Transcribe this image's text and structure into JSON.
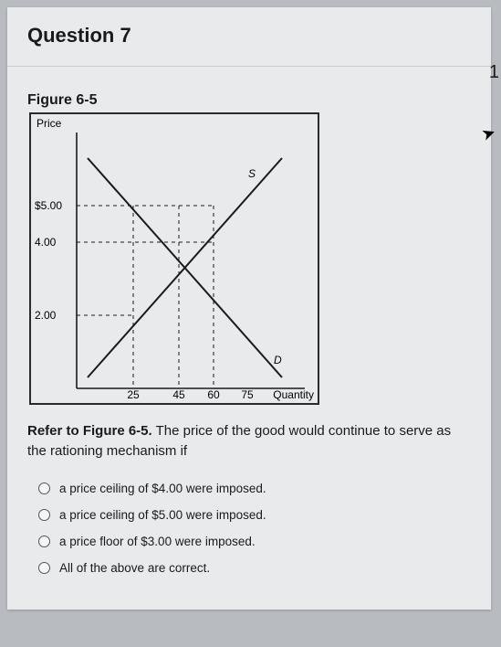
{
  "header": {
    "title": "Question 7"
  },
  "figure": {
    "title": "Figure 6-5"
  },
  "corner": {
    "num": "1"
  },
  "chart_data": {
    "type": "line",
    "xlabel": "Quantity",
    "ylabel": "Price",
    "x_ticks": [
      25,
      45,
      60,
      75
    ],
    "y_ticks": [
      "$5.00",
      "4.00",
      "2.00"
    ],
    "y_tick_values": [
      5.0,
      4.0,
      2.0
    ],
    "series": [
      {
        "name": "S",
        "points": [
          [
            5,
            0.3
          ],
          [
            90,
            6.3
          ]
        ]
      },
      {
        "name": "D",
        "points": [
          [
            5,
            6.3
          ],
          [
            90,
            0.3
          ]
        ]
      }
    ],
    "guide_lines": [
      {
        "y": 5.0,
        "x_to": 60
      },
      {
        "y": 4.0,
        "x_to": 60
      },
      {
        "y": 2.0,
        "x_to": 25
      },
      {
        "x": 25,
        "y_to": 5.0
      },
      {
        "x": 45,
        "y_to": 5.0
      },
      {
        "x": 60,
        "y_to": 5.0
      }
    ],
    "equilibrium": {
      "x": 45,
      "y": 4.0
    }
  },
  "question": {
    "lead_bold": "Refer to Figure 6-5.",
    "rest": " The price of the good would continue to serve as the rationing mechanism if"
  },
  "options": {
    "a": "a price ceiling of $4.00 were imposed.",
    "b": "a price ceiling of $5.00 were imposed.",
    "c": "a price floor of $3.00 were imposed.",
    "d": "All of the above are correct."
  }
}
